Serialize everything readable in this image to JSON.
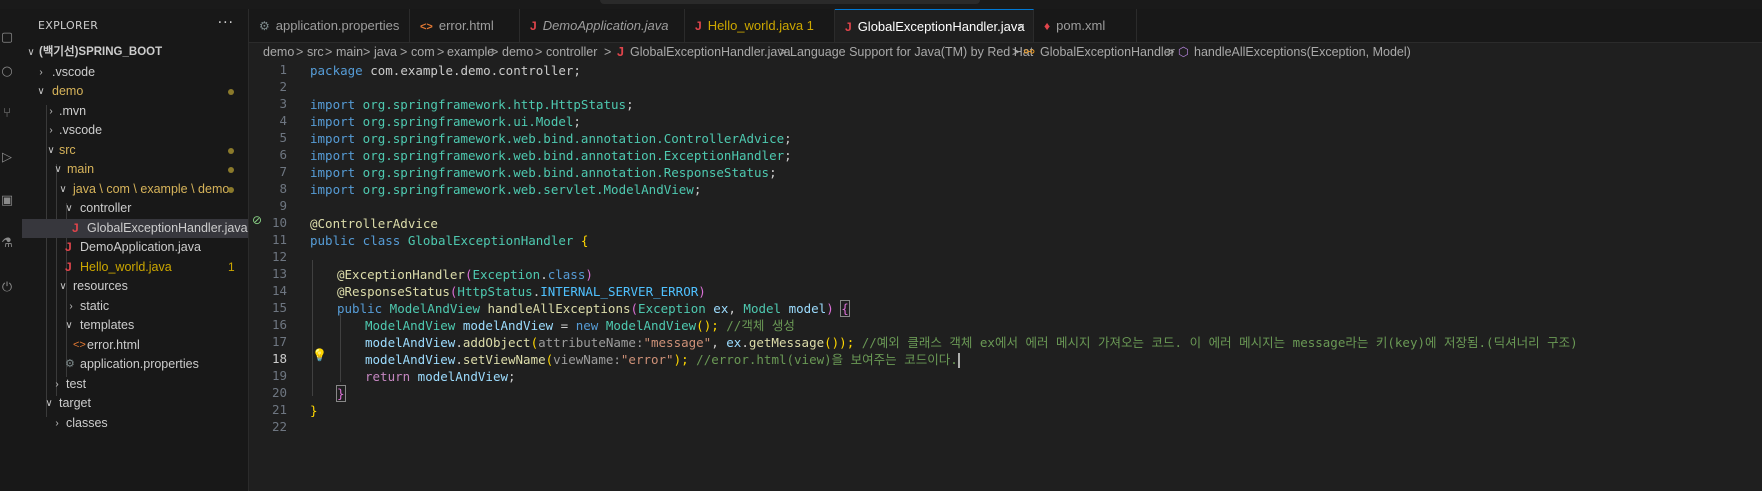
{
  "activity_bar": {
    "icons": [
      "files-icon",
      "search-icon",
      "source-control-icon",
      "run-debug-icon",
      "extensions-icon",
      "testing-icon",
      "spring-boot-icon"
    ]
  },
  "sidebar": {
    "header": "EXPLORER",
    "more": "···",
    "tree": [
      {
        "label": "(백기선)SPRING_BOOT",
        "indent": 0,
        "chev": "v"
      },
      {
        "label": ".vscode",
        "indent": 1,
        "chev": ">"
      },
      {
        "label": "demo",
        "indent": 1,
        "chev": "v"
      },
      {
        "label": ".mvn",
        "indent": 2,
        "chev": ">"
      },
      {
        "label": ".vscode",
        "indent": 2,
        "chev": ">"
      },
      {
        "label": "src",
        "indent": 2,
        "chev": "v"
      },
      {
        "label": "main",
        "indent": 3,
        "chev": "v"
      },
      {
        "label": "java \\ com \\ example \\ demo",
        "indent": 4,
        "chev": "v"
      },
      {
        "label": "controller",
        "indent": 5,
        "chev": "v"
      },
      {
        "label": "GlobalExceptionHandler.java",
        "indent": 6,
        "chev": ""
      },
      {
        "label": "DemoApplication.java",
        "indent": 5,
        "chev": ""
      },
      {
        "label": "Hello_world.java",
        "indent": 5,
        "chev": "",
        "badge": "1"
      },
      {
        "label": "resources",
        "indent": 4,
        "chev": "v"
      },
      {
        "label": "static",
        "indent": 5,
        "chev": ">"
      },
      {
        "label": "templates",
        "indent": 5,
        "chev": "v"
      },
      {
        "label": "error.html",
        "indent": 6,
        "chev": ""
      },
      {
        "label": "application.properties",
        "indent": 5,
        "chev": ""
      },
      {
        "label": "test",
        "indent": 3,
        "chev": ">"
      },
      {
        "label": "target",
        "indent": 2,
        "chev": "v"
      },
      {
        "label": "classes",
        "indent": 3,
        "chev": ">"
      }
    ]
  },
  "tabs": [
    {
      "label": "application.properties"
    },
    {
      "label": "error.html"
    },
    {
      "label": "DemoApplication.java"
    },
    {
      "label": "Hello_world.java 1"
    },
    {
      "label": "GlobalExceptionHandler.java",
      "close": "×"
    },
    {
      "label": "pom.xml"
    }
  ],
  "breadcrumb": {
    "items": [
      "demo",
      "src",
      "main",
      "java",
      "com",
      "example",
      "demo",
      "controller",
      "GlobalExceptionHandler.java",
      "Language Support for Java(TM) by Red Hat",
      "GlobalExceptionHandler",
      "handleAllExceptions(Exception, Model)"
    ],
    "separator": ">"
  },
  "editor": {
    "line_numbers": [
      "1",
      "2",
      "3",
      "4",
      "5",
      "6",
      "7",
      "8",
      "9",
      "10",
      "11",
      "12",
      "13",
      "14",
      "15",
      "16",
      "17",
      "18",
      "19",
      "20",
      "21",
      "22"
    ],
    "current_line": "18",
    "code": {
      "l1_kw": "package",
      "l1_rest": " com.example.demo.controller;",
      "imp": "import",
      "l4_pkg": " org.springframework.http.",
      "l4_ty": "HttpStatus",
      "semi": ";",
      "l5_pkg": " org.springframework.ui.",
      "l5_ty": "Model",
      "l6_pkg": " org.springframework.web.bind.annotation.",
      "l6_ty": "ControllerAdvice",
      "l7_pkg": " org.springframework.web.bind.annotation.",
      "l7_ty": "ExceptionHandler",
      "l8_pkg": " org.springframework.web.bind.annotation.",
      "l8_ty": "ResponseStatus",
      "l9_pkg": " org.springframework.web.servlet.",
      "l9_ty": "ModelAndView",
      "l10_ann": "@ControllerAdvice",
      "l11_kw1": "public",
      "l11_kw2": " class",
      "l11_ty": " GlobalExceptionHandler",
      "l11_br": " {",
      "l13_ann": "@ExceptionHandler",
      "l13_p1": "(",
      "l13_ty": "Exception",
      "l13_dot": ".",
      "l13_kw": "class",
      "l13_p2": ")",
      "l14_ann": "@ResponseStatus",
      "l14_p1": "(",
      "l14_ty": "HttpStatus",
      "l14_dot": ".",
      "l14_cst": "INTERNAL_SERVER_ERROR",
      "l14_p2": ")",
      "l15_kw": "public",
      "l15_ty": " ModelAndView",
      "l15_fn": " handleAllExceptions",
      "l15_p1": "(",
      "l15_ty2": "Exception",
      "l15_v1": " ex",
      "l15_c": ",",
      "l15_ty3": " Model",
      "l15_v2": " model",
      "l15_p2": ")",
      "l15_br": "{",
      "l16_ty": "ModelAndView",
      "l16_v": " modelAndView",
      "l16_eq": " =",
      "l16_kw": " new",
      "l16_ty2": " ModelAndView",
      "l16_p": "();",
      "l16_cm": " //객체 생성",
      "l17_v": "modelAndView",
      "l17_dot": ".",
      "l17_fn": "addObject",
      "l17_p1": "(",
      "l17_hint": "attributeName:",
      "l17_str": "\"message\"",
      "l17_c": ", ",
      "l17_v2": "ex",
      "l17_dot2": ".",
      "l17_fn2": "getMessage",
      "l17_p2": "());",
      "l17_cm": " //예외 클래스 객체 ex에서 에러 메시지 가져오는 코드. 이 에러 메시지는 message라는 키(key)에 저장됨.(딕셔너리 구조)",
      "l18_v": "modelAndView",
      "l18_dot": ".",
      "l18_fn": "setViewName",
      "l18_p1": "(",
      "l18_hint": "viewName:",
      "l18_str": "\"error\"",
      "l18_p2": ");",
      "l18_cm": " //error.html(view)을 보여주는 코드이다.",
      "l19_kw": "return",
      "l19_v": " modelAndView",
      "l19_semi": ";",
      "l20_br": "}",
      "l21_br": "}"
    }
  }
}
